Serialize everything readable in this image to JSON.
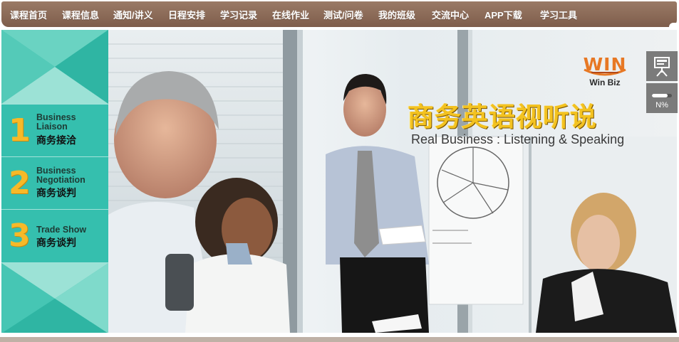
{
  "nav": {
    "items": [
      "课程首页",
      "课程信息",
      "通知/讲义",
      "日程安排",
      "学习记录",
      "在线作业",
      "测试/问卷",
      "我的班级",
      "交流中心",
      "APP下载",
      "学习工具"
    ]
  },
  "side_menu": [
    {
      "number": "1",
      "en": [
        "Business",
        "Liaison"
      ],
      "cn": "商务接洽"
    },
    {
      "number": "2",
      "en": [
        "Business",
        "Negotiation"
      ],
      "cn": "商务谈判"
    },
    {
      "number": "3",
      "en": [
        "Trade Show"
      ],
      "cn": "商务谈判"
    }
  ],
  "logo": {
    "mark": "WIN",
    "text": "Win Biz"
  },
  "banner": {
    "title_cn": "商务英语视听说",
    "title_en": "Real Business : Listening & Speaking"
  },
  "tools": {
    "progress_label": "N%",
    "progress_value": 0.8
  },
  "colors": {
    "nav": "#8a6b58",
    "accent_teal": "#35bfae",
    "number_gold": "#f7b928",
    "title_gold": "#f3c220",
    "logo_orange": "#e77824",
    "tool_gray": "#7b7b7b"
  },
  "icons": [
    "presentation-board-icon",
    "progress-bar-icon"
  ]
}
